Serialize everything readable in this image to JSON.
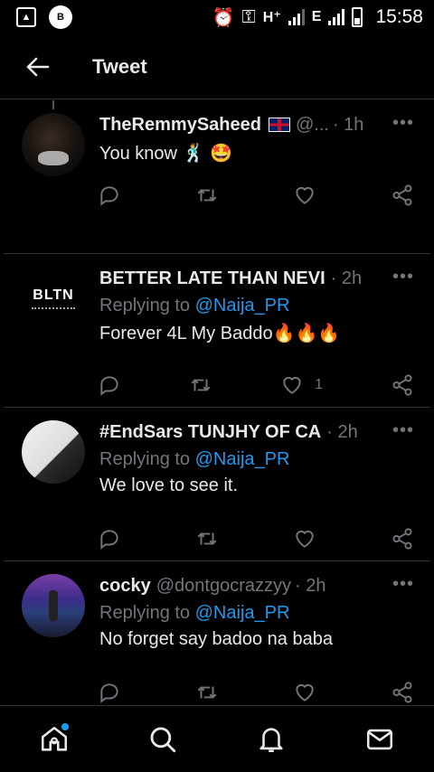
{
  "status_bar": {
    "time": "15:58",
    "network_1": "H⁺",
    "network_2": "E"
  },
  "header": {
    "title": "Tweet"
  },
  "tweets": [
    {
      "name": "TheRemmySaheed",
      "handle": "@...",
      "time": "· 1h",
      "reply_prefix": "",
      "mention": "",
      "text": "You know 🕺 🤩",
      "likes": ""
    },
    {
      "name": "BETTER LATE THAN NEVI",
      "handle": "",
      "time": "· 2h",
      "reply_prefix": "Replying to ",
      "mention": "@Naija_PR",
      "text": "Forever 4L My Baddo🔥🔥🔥",
      "likes": "1",
      "avatar_text": "BLTN"
    },
    {
      "name": "#EndSars TUNJHY OF CA",
      "handle": "",
      "time": "· 2h",
      "reply_prefix": "Replying to ",
      "mention": "@Naija_PR",
      "text": "We love to see it.",
      "likes": ""
    },
    {
      "name": "cocky",
      "handle": "@dontgocrazzyy",
      "time": "· 2h",
      "reply_prefix": "Replying to ",
      "mention": "@Naija_PR",
      "text": "No forget say badoo na baba",
      "likes": ""
    }
  ],
  "bottom_nav": [
    "home-icon",
    "search-icon",
    "bell-icon",
    "mail-icon"
  ],
  "colors": {
    "accent": "#1d9bf0",
    "muted": "#71767b",
    "background": "#000000"
  }
}
